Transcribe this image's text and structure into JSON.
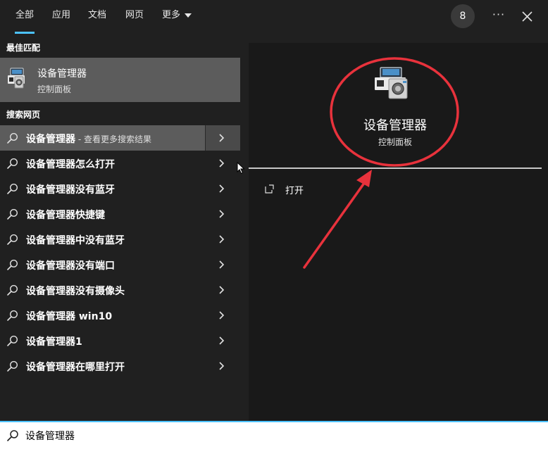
{
  "tabs": [
    {
      "label": "全部",
      "active": true
    },
    {
      "label": "应用",
      "active": false
    },
    {
      "label": "文档",
      "active": false
    },
    {
      "label": "网页",
      "active": false
    },
    {
      "label": "更多",
      "active": false
    }
  ],
  "header": {
    "badge_count": "8",
    "more_label": "···"
  },
  "best_match": {
    "section_label": "最佳匹配",
    "title": "设备管理器",
    "subtitle": "控制面板",
    "icon": "device-manager-icon"
  },
  "web_search": {
    "section_label": "搜索网页",
    "results": [
      {
        "text": "设备管理器",
        "suffix": " - 查看更多搜索结果",
        "highlighted": true
      },
      {
        "text": "设备管理器怎么打开",
        "suffix": ""
      },
      {
        "text": "设备管理器没有蓝牙",
        "suffix": ""
      },
      {
        "text": "设备管理器快捷键",
        "suffix": ""
      },
      {
        "text": "设备管理器中没有蓝牙",
        "suffix": ""
      },
      {
        "text": "设备管理器没有端口",
        "suffix": ""
      },
      {
        "text": "设备管理器没有摄像头",
        "suffix": ""
      },
      {
        "text": "设备管理器 win10",
        "suffix": ""
      },
      {
        "text": "设备管理器1",
        "suffix": ""
      },
      {
        "text": "设备管理器在哪里打开",
        "suffix": ""
      }
    ]
  },
  "detail": {
    "title": "设备管理器",
    "subtitle": "控制面板",
    "actions": [
      {
        "label": "打开",
        "icon": "open-external-icon"
      }
    ]
  },
  "search": {
    "value": "设备管理器",
    "placeholder": ""
  },
  "colors": {
    "accent": "#4cc2ff",
    "annotation_red": "#e8323c",
    "highlight_bg": "#5c5c5c"
  }
}
